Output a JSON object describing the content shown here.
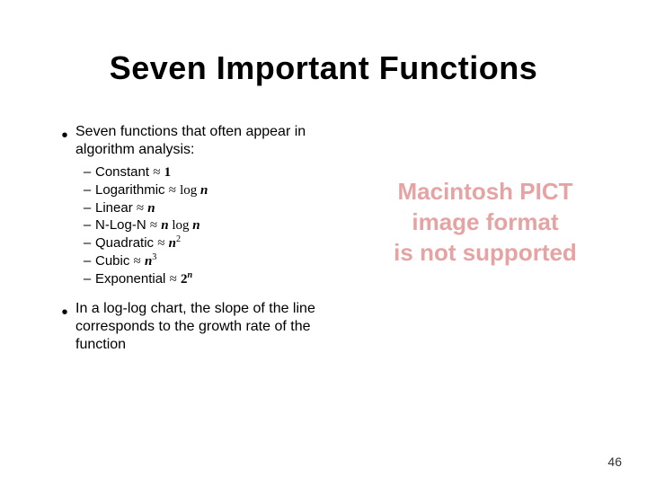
{
  "slide": {
    "title": "Seven Important Functions",
    "bullets": [
      {
        "text": "Seven functions that often appear in algorithm analysis:"
      },
      {
        "text": "In a log-log chart, the slope of the line corresponds to the growth rate of the function"
      }
    ],
    "functions": [
      {
        "name": "Constant",
        "approx": "≈",
        "expr_html": "<span class='mn'>1</span>"
      },
      {
        "name": "Logarithmic",
        "approx": "≈",
        "expr_html": "log <span class='mi'>n</span>"
      },
      {
        "name": "Linear",
        "approx": "≈",
        "expr_html": "<span class='mi'>n</span>"
      },
      {
        "name": "N-Log-N",
        "approx": "≈",
        "expr_html": "<span class='mi'>n</span> log <span class='mi'>n</span>"
      },
      {
        "name": "Quadratic",
        "approx": "≈",
        "expr_html": "<span class='mi'>n</span><sup>2</sup>"
      },
      {
        "name": "Cubic",
        "approx": "≈",
        "expr_html": "<span class='mi'>n</span><sup>3</sup>"
      },
      {
        "name": "Exponential",
        "approx": "≈",
        "expr_html": "<span class='mn'>2</span><sup><span class='mi'>n</span></sup>"
      }
    ],
    "placeholder": {
      "line1": "Macintosh PICT",
      "line2": "image format",
      "line3": "is not supported"
    },
    "page_number": "46",
    "bullet_glyph": "•",
    "dash_glyph": "–"
  }
}
